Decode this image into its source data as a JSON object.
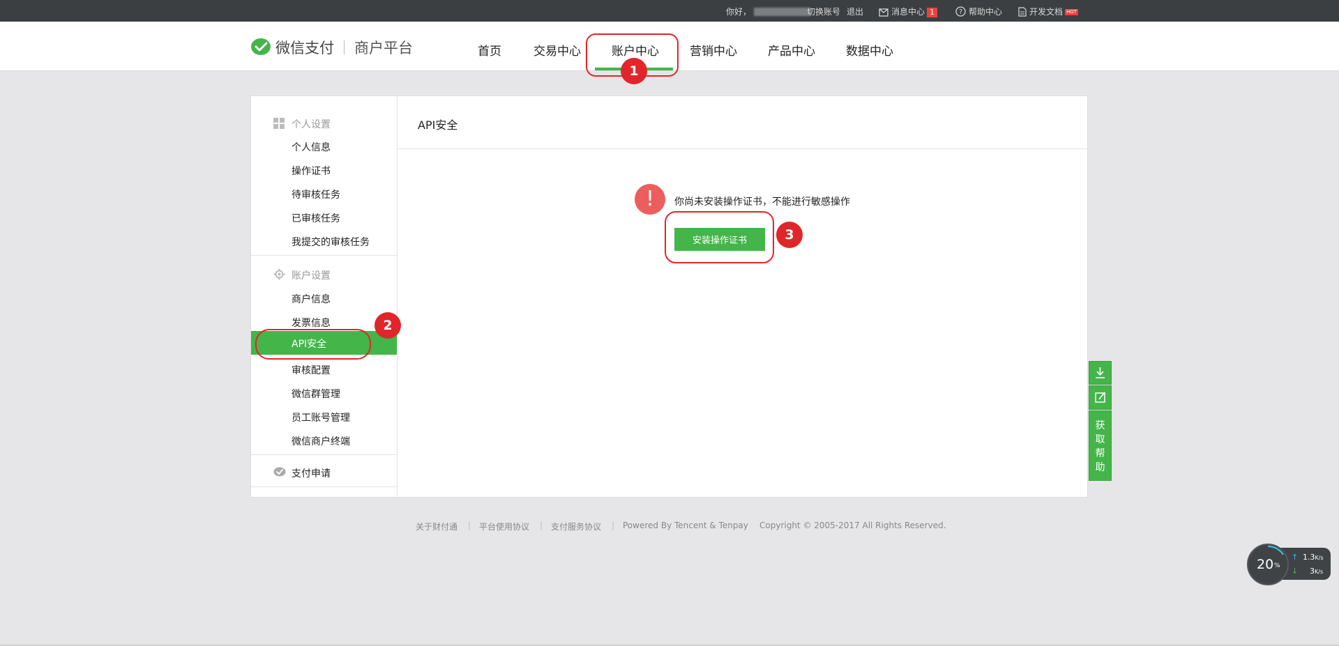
{
  "topbar": {
    "greeting": "你好，",
    "switch_account": "切换账号",
    "logout": "退出",
    "messages": "消息中心",
    "messages_count": "1",
    "help": "帮助中心",
    "dev_docs": "开发文档",
    "hot_badge": "HOT"
  },
  "header": {
    "brand": "微信支付",
    "platform": "商户平台",
    "nav": [
      "首页",
      "交易中心",
      "账户中心",
      "营销中心",
      "产品中心",
      "数据中心"
    ],
    "active_nav": "账户中心"
  },
  "sidebar": {
    "personal_title": "个人设置",
    "personal_items": [
      "个人信息",
      "操作证书",
      "待审核任务",
      "已审核任务",
      "我提交的审核任务"
    ],
    "account_title": "账户设置",
    "account_items": [
      "商户信息",
      "发票信息",
      "API安全",
      "审核配置",
      "微信群管理",
      "员工账号管理",
      "微信商户终端"
    ],
    "active_item": "API安全",
    "payment_apply": "支付申请"
  },
  "content": {
    "title": "API安全",
    "warning_glyph": "!",
    "warning": "你尚未安装操作证书，不能进行敏感操作",
    "install_button": "安装操作证书"
  },
  "annotations": [
    "1",
    "2",
    "3"
  ],
  "footer": {
    "about": "关于财付通",
    "terms": "平台使用协议",
    "pay_terms": "支付服务协议",
    "powered": "Powered By Tencent & Tenpay",
    "copyright": "Copyright © 2005-2017 All Rights Reserved."
  },
  "float_tools": {
    "help_label": "获取帮助"
  },
  "speed_widget": {
    "percent": "20",
    "percent_unit": "%",
    "upload": "1.3",
    "upload_unit": "K/s",
    "download": "3",
    "download_unit": "K/s"
  },
  "colors": {
    "brand_green": "#44b549",
    "topbar": "#3b3f42",
    "annotation_red": "#e0262a",
    "warning_red": "#ec5e5e"
  }
}
